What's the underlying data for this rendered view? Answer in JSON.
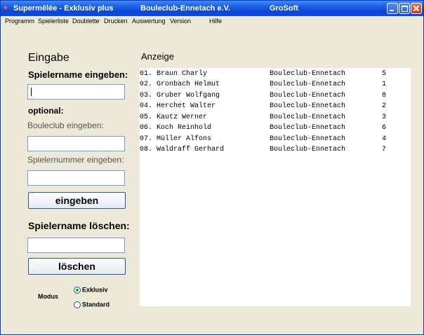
{
  "window": {
    "title_app": "Supermêlée - Exklusiv plus",
    "title_club": "Bouleclub-Ennetach e.V.",
    "title_vendor": "GroSoft"
  },
  "menu": [
    "Programm",
    "Spielerliste",
    "Doublette",
    "Drucken",
    "Auswertung",
    "Version",
    "Hilfe"
  ],
  "input_panel": {
    "heading": "Eingabe",
    "name_label": "Spielername eingeben:",
    "name_value": "",
    "optional_label": "optional:",
    "club_label": "Bouleclub eingeben:",
    "club_value": "",
    "number_label": "Spielernummer eingeben:",
    "number_value": "",
    "submit_label": "eingeben",
    "delete_heading": "Spielername löschen:",
    "delete_value": "",
    "delete_label": "löschen",
    "mode_label": "Modus",
    "mode_options": [
      "Exklusiv",
      "Standard"
    ],
    "mode_selected": "Exklusiv"
  },
  "display_panel": {
    "heading": "Anzeige",
    "players": [
      {
        "entry": "01. Braun Charly",
        "club": "Bouleclub-Ennetach",
        "number": "5"
      },
      {
        "entry": "02. Gronbach Helmut",
        "club": "Bouleclub-Ennetach",
        "number": "1"
      },
      {
        "entry": "03. Gruber Wolfgang",
        "club": "Bouleclub-Ennetach",
        "number": "8"
      },
      {
        "entry": "04. Herchet Walter",
        "club": "Bouleclub-Ennetach",
        "number": "2"
      },
      {
        "entry": "05. Kautz Werner",
        "club": "Bouleclub-Ennetach",
        "number": "3"
      },
      {
        "entry": "06. Koch Reinhold",
        "club": "Bouleclub-Ennetach",
        "number": "6"
      },
      {
        "entry": "07. Müller Alfons",
        "club": "Bouleclub-Ennetach",
        "number": "4"
      },
      {
        "entry": "08. Waldraff Gerhard",
        "club": "Bouleclub-Ennetach",
        "number": "7"
      }
    ]
  }
}
